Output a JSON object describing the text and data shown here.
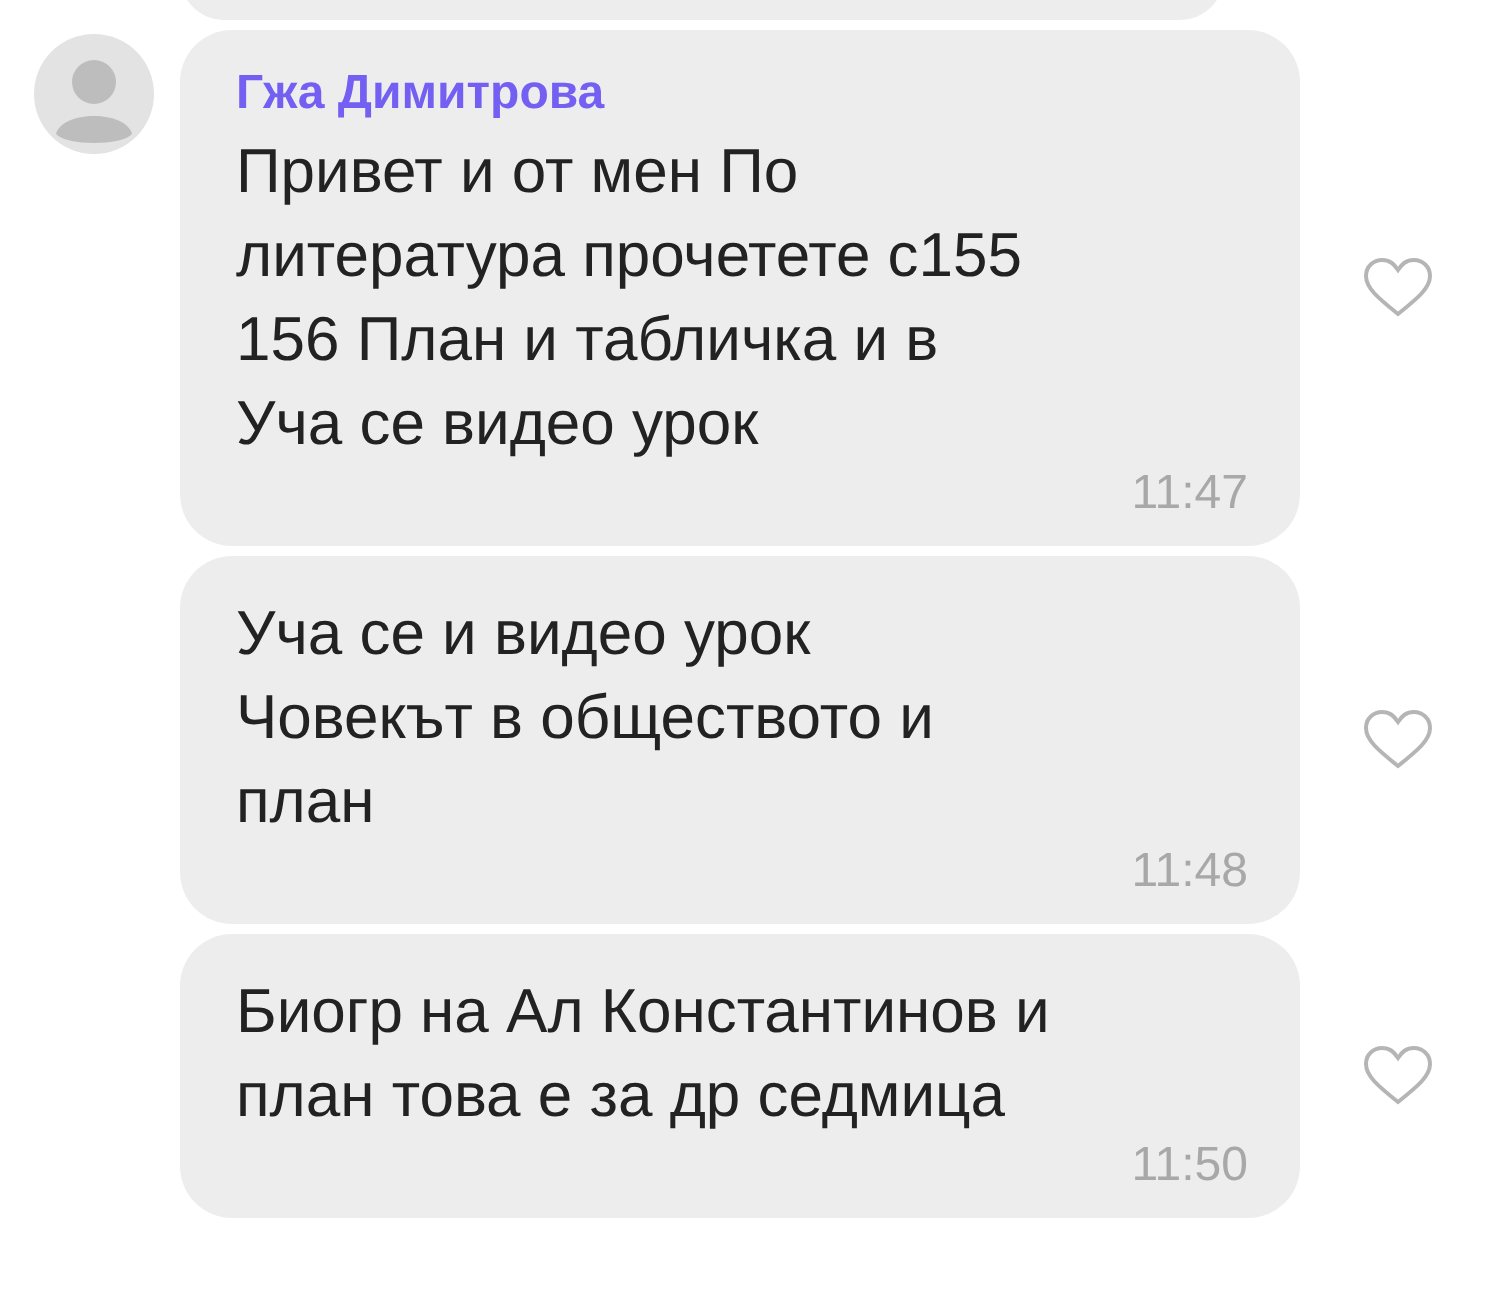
{
  "messages": [
    {
      "sender": "Гжа Димитрова",
      "text": "Привет и от мен По\nлитература прочетете с155\n156 План и табличка и в\nУча се видео урок",
      "time": "11:47"
    },
    {
      "text": "Уча се и видео урок\nЧовекът в обществото и\nплан",
      "time": "11:48"
    },
    {
      "text": "Биогр на Ал Константинов и\nплан това е за др седмица",
      "time": "11:50"
    }
  ]
}
